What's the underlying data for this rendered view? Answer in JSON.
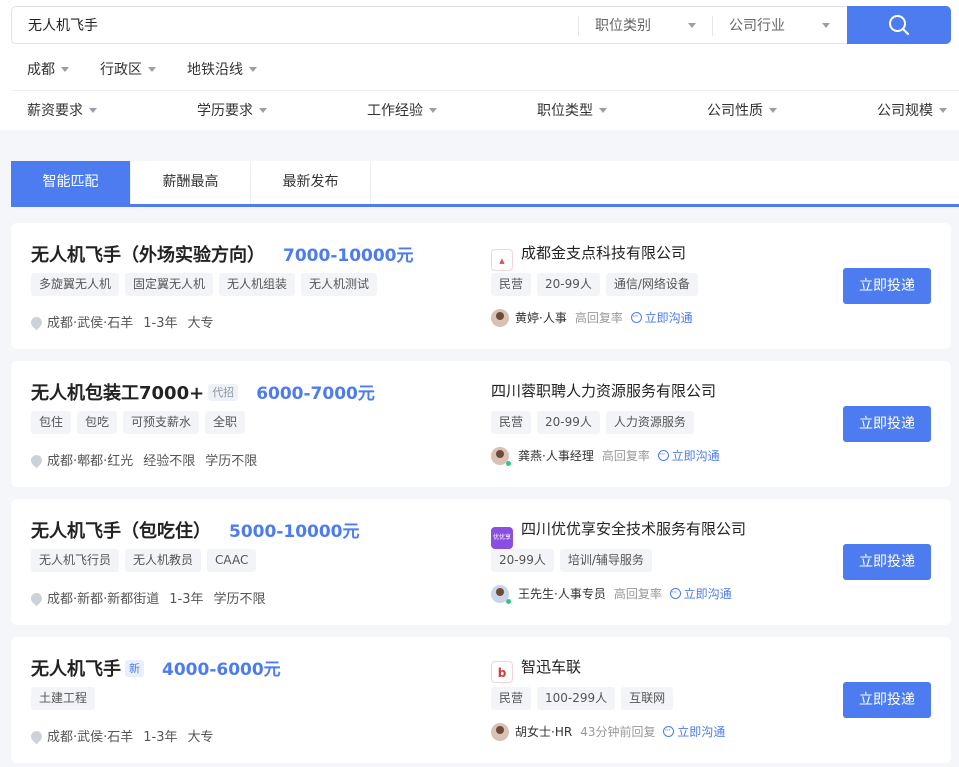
{
  "search": {
    "value": "无人机飞手",
    "category_label": "职位类别",
    "industry_label": "公司行业"
  },
  "location_filters": [
    "成都",
    "行政区",
    "地铁沿线"
  ],
  "requirement_filters": [
    "薪资要求",
    "学历要求",
    "工作经验",
    "职位类型",
    "公司性质",
    "公司规模"
  ],
  "tabs": [
    "智能匹配",
    "薪酬最高",
    "最新发布"
  ],
  "jobs": [
    {
      "title": "无人机飞手（外场实验方向）",
      "badge": "",
      "salary": "7000-10000元",
      "tags": [
        "多旋翼无人机",
        "固定翼无人机",
        "无人机组装",
        "无人机测试"
      ],
      "location": "成都·武侯·石羊",
      "experience": "1-3年",
      "education": "大专",
      "company": "成都金支点科技有限公司",
      "company_tags": [
        "民营",
        "20-99人",
        "通信/网络设备"
      ],
      "recruiter": "黄婷·人事",
      "reply": "高回复率",
      "chat": "立即沟通",
      "apply": "立即投递"
    },
    {
      "title": "无人机包装工7000+",
      "badge": "代招",
      "salary": "6000-7000元",
      "tags": [
        "包住",
        "包吃",
        "可预支薪水",
        "全职"
      ],
      "location": "成都·郫都·红光",
      "experience": "经验不限",
      "education": "学历不限",
      "company": "四川蓉职聘人力资源服务有限公司",
      "company_tags": [
        "民营",
        "20-99人",
        "人力资源服务"
      ],
      "recruiter": "龚燕·人事经理",
      "reply": "高回复率",
      "chat": "立即沟通",
      "apply": "立即投递"
    },
    {
      "title": "无人机飞手（包吃住）",
      "badge": "",
      "salary": "5000-10000元",
      "tags": [
        "无人机飞行员",
        "无人机教员",
        "CAAC"
      ],
      "location": "成都·新都·新都街道",
      "experience": "1-3年",
      "education": "学历不限",
      "company": "四川优优享安全技术服务有限公司",
      "company_logo_text": "优优享",
      "company_tags": [
        "20-99人",
        "培训/辅导服务"
      ],
      "recruiter": "王先生·人事专员",
      "reply": "高回复率",
      "chat": "立即沟通",
      "apply": "立即投递"
    },
    {
      "title": "无人机飞手",
      "badge": "新",
      "salary": "4000-6000元",
      "tags": [
        "土建工程"
      ],
      "location": "成都·武侯·石羊",
      "experience": "1-3年",
      "education": "大专",
      "company": "智迅车联",
      "company_tags": [
        "民营",
        "100-299人",
        "互联网"
      ],
      "recruiter": "胡女士·HR",
      "reply": "43分钟前回复",
      "chat": "立即沟通",
      "apply": "立即投递"
    }
  ],
  "colors": {
    "accent": "#4d7cf0",
    "online": "#2cc58d"
  },
  "icons": [
    "search-icon",
    "location-pin-icon",
    "chat-icon",
    "avatar"
  ]
}
